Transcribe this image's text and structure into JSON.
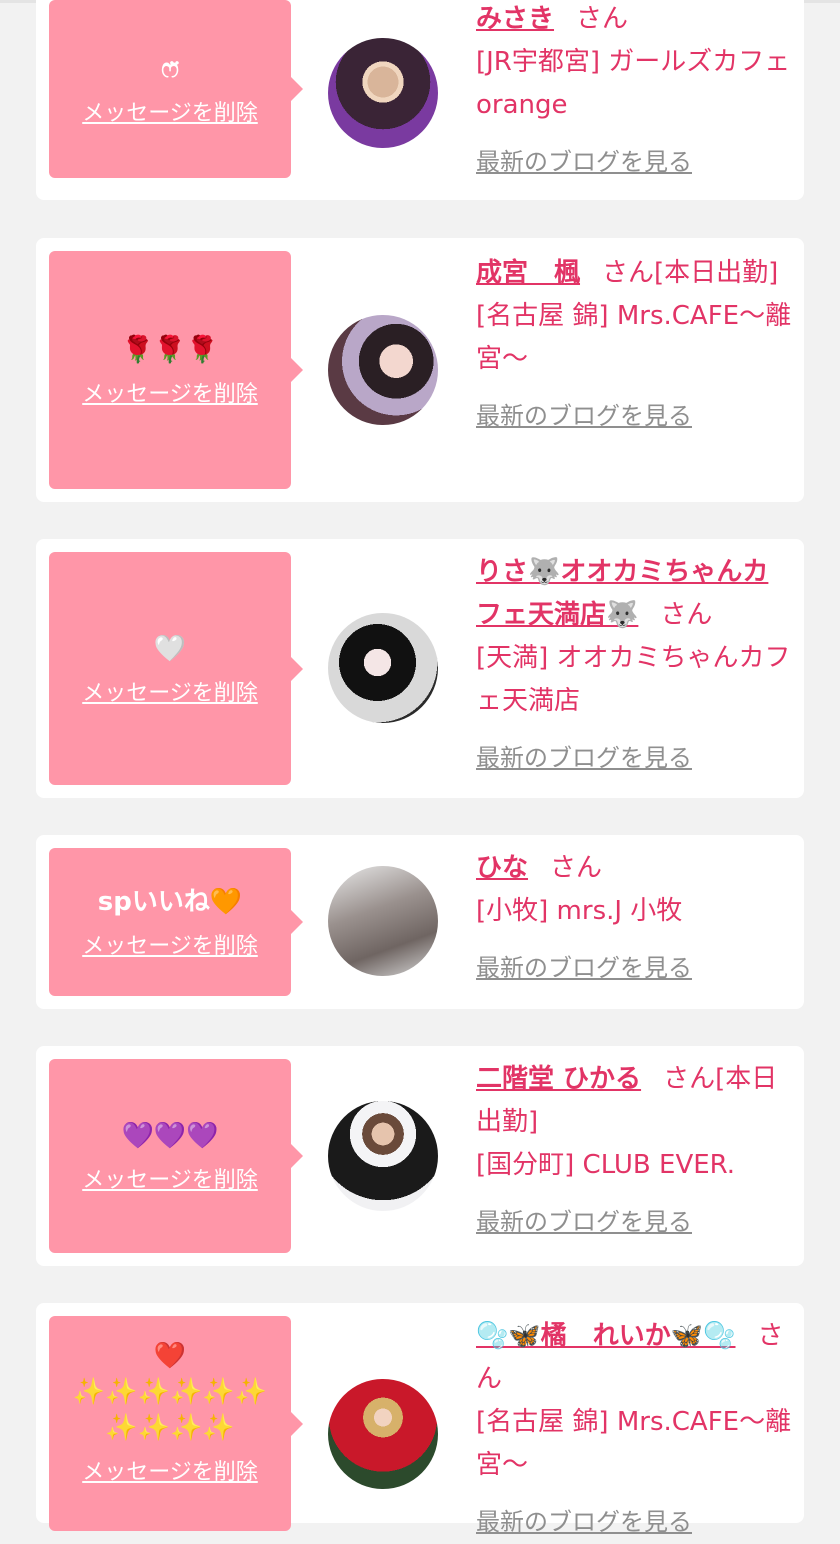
{
  "colors": {
    "accent": "#e23466",
    "bubble": "#ff96a8",
    "link_gray": "#8f8f8f",
    "background": "#f2f2f2"
  },
  "delete_label": "メッセージを削除",
  "blog_label": "最新のブログを見る",
  "cards": [
    {
      "message": "ෆ̈",
      "name": "みさき",
      "suffix": "さん",
      "shop": "[JR宇都宮] ガールズカフェ orange"
    },
    {
      "message": "🌹🌹🌹",
      "name": "成宮　楓",
      "suffix": "さん[本日出勤]",
      "shop": "[名古屋 錦] Mrs.CAFE〜離宮〜"
    },
    {
      "message": "🤍",
      "name": "りさ🐺オオカミちゃんカフェ天満店🐺",
      "suffix": "さん",
      "shop": "[天満] オオカミちゃんカフェ天満店"
    },
    {
      "message": "spいいね🧡",
      "name": "ひな",
      "suffix": "さん",
      "shop": "[小牧] mrs.J 小牧"
    },
    {
      "message": "💜💜💜",
      "name": "二階堂 ひかる",
      "suffix": "さん[本日出勤]",
      "shop": "[国分町] CLUB EVER."
    },
    {
      "message": "❤️\n✨✨✨✨✨✨\n✨✨✨✨",
      "name": "🫧🦋橘　れいか🦋🫧",
      "suffix": "さん",
      "shop": "[名古屋 錦] Mrs.CAFE〜離宮〜"
    }
  ]
}
